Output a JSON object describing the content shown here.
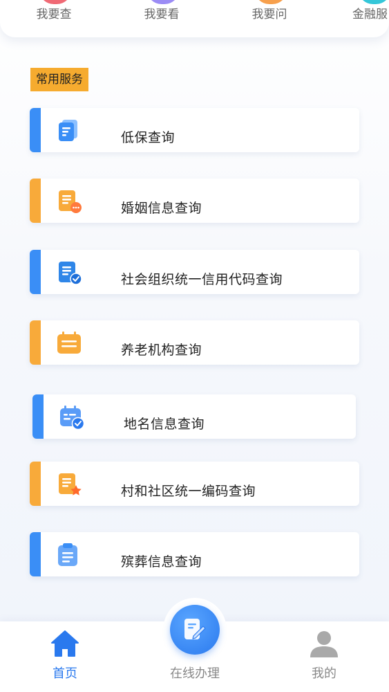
{
  "quick_actions": [
    {
      "label": "我要查",
      "color": "#f06a75"
    },
    {
      "label": "我要看",
      "color": "#9b8cf5"
    },
    {
      "label": "我要问",
      "color": "#f7a04d"
    },
    {
      "label": "金融服",
      "color": "#35c7d9"
    }
  ],
  "section": {
    "title": "常用服务"
  },
  "services": [
    {
      "label": "低保查询",
      "accent": "#3a8ef6",
      "icon": "document-list-icon"
    },
    {
      "label": "婚姻信息查询",
      "accent": "#f8aa3a",
      "icon": "document-chat-icon"
    },
    {
      "label": "社会组织统一信用代码查询",
      "accent": "#3a8ef6",
      "icon": "document-check-icon"
    },
    {
      "label": "养老机构查询",
      "accent": "#f8aa3a",
      "icon": "calendar-icon"
    },
    {
      "label": "地名信息查询",
      "accent": "#3a8ef6",
      "icon": "calendar-check-icon"
    },
    {
      "label": "村和社区统一编码查询",
      "accent": "#f8aa3a",
      "icon": "document-star-icon"
    },
    {
      "label": "殡葬信息查询",
      "accent": "#3a8ef6",
      "icon": "clipboard-icon"
    }
  ],
  "tabbar": {
    "home": "首页",
    "online": "在线办理",
    "mine": "我的"
  },
  "colors": {
    "primary": "#2a79ee",
    "orange": "#f8aa3a",
    "inactive": "#888888"
  }
}
